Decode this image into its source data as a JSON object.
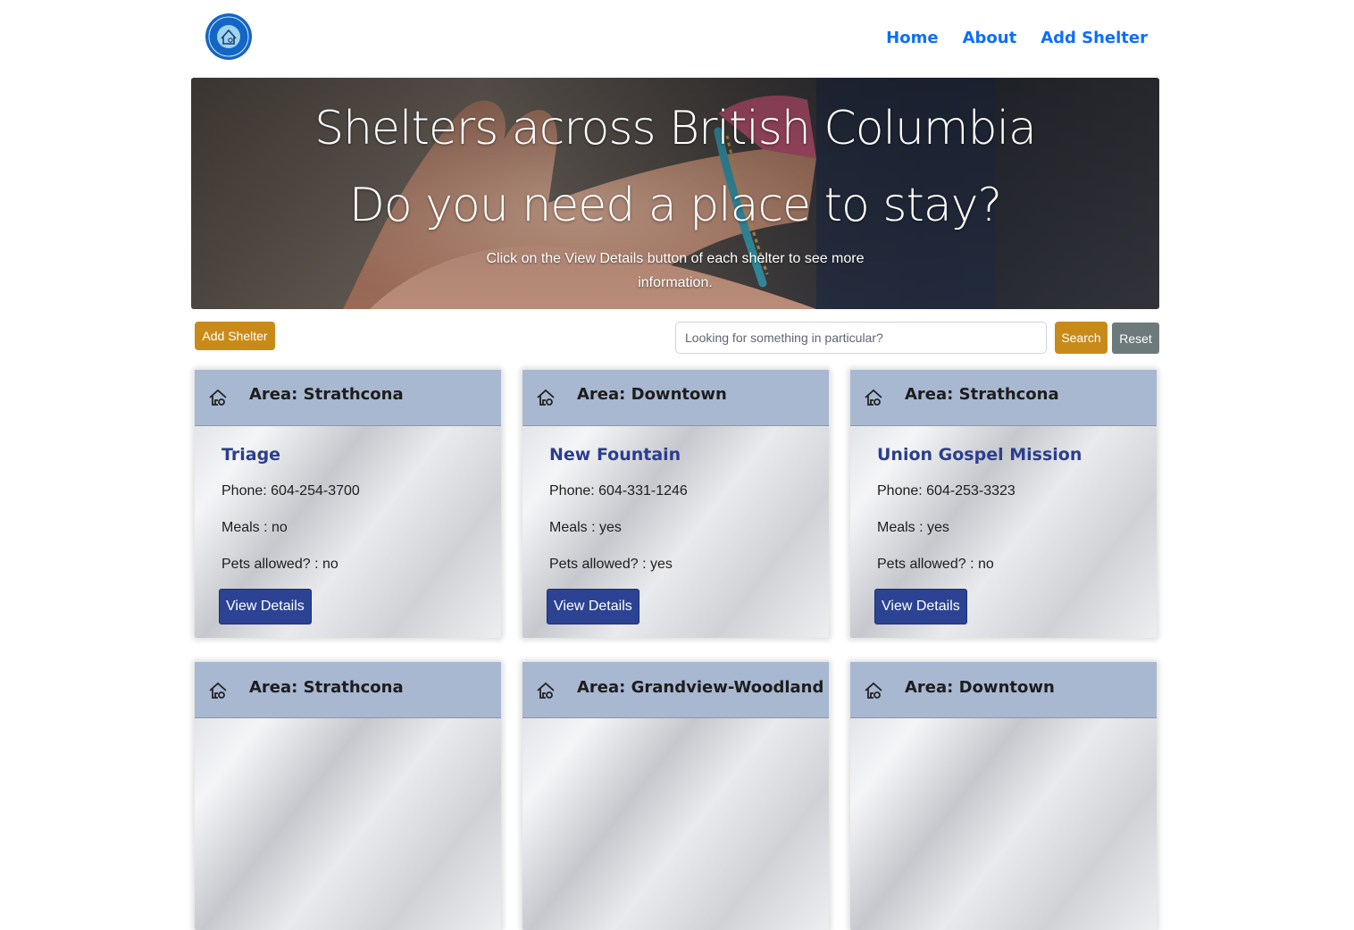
{
  "nav": {
    "logo_alt": "Shelters in BC",
    "links": [
      {
        "label": "Home"
      },
      {
        "label": "About"
      },
      {
        "label": "Add Shelter"
      }
    ]
  },
  "hero": {
    "title": "Shelters across British Columbia",
    "subtitle": "Do you need a place to stay?",
    "description_line1": "Click on the View Details button of each shelter to see more",
    "description_line2": "information."
  },
  "toolbar": {
    "add_label": "Add Shelter",
    "search_placeholder": "Looking for something in particular?",
    "search_label": "Search",
    "reset_label": "Reset"
  },
  "cards": [
    {
      "area": "Area: Strathcona",
      "name": "Triage",
      "phone": "Phone: 604-254-3700",
      "meals": "Meals : no",
      "pets": "Pets allowed? : no",
      "button": "View Details"
    },
    {
      "area": "Area: Downtown",
      "name": "New Fountain",
      "phone": "Phone: 604-331-1246",
      "meals": "Meals : yes",
      "pets": "Pets allowed? : yes",
      "button": "View Details"
    },
    {
      "area": "Area: Strathcona",
      "name": "Union Gospel Mission",
      "phone": "Phone: 604-253-3323",
      "meals": "Meals : yes",
      "pets": "Pets allowed? : no",
      "button": "View Details"
    },
    {
      "area": "Area: Strathcona"
    },
    {
      "area": "Area: Grandview-Woodland"
    },
    {
      "area": "Area: Downtown"
    }
  ],
  "colors": {
    "nav_link": "#0d6efd",
    "accent_gold": "#c88b1a",
    "reset_gray": "#6c7a7c",
    "card_header": "#a8b8d1",
    "shelter_name": "#2b3e8e",
    "view_button": "#2c4393"
  },
  "icons": {
    "logo": "house-badge-logo",
    "card_icon": "house-icon"
  }
}
